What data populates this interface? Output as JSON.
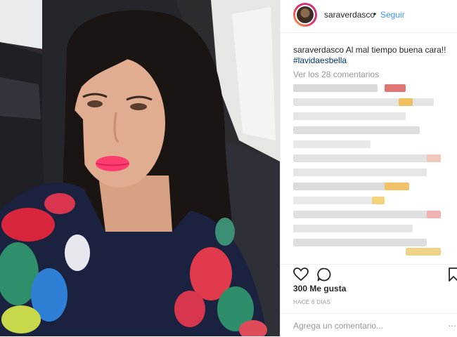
{
  "post": {
    "username": "saraverdasco",
    "separator": "•",
    "follow_label": "Seguir",
    "caption_user": "saraverdasco",
    "caption_text": "Al mal tiempo buena cara!!",
    "hashtag": "#lavidaesbella",
    "view_comments": "Ver los 28 comentarios",
    "likes_label": "300 Me gusta",
    "timestamp": "HACE 6 DÍAS",
    "comment_placeholder": "Agrega un comentario...",
    "more_glyph": "···"
  },
  "icons": {
    "like": "heart-icon",
    "comment": "speech-bubble-icon",
    "save": "bookmark-icon",
    "more": "ellipsis-icon"
  },
  "colors": {
    "link": "#3897f0",
    "text": "#262626",
    "muted": "#999999",
    "border": "#efefef"
  }
}
